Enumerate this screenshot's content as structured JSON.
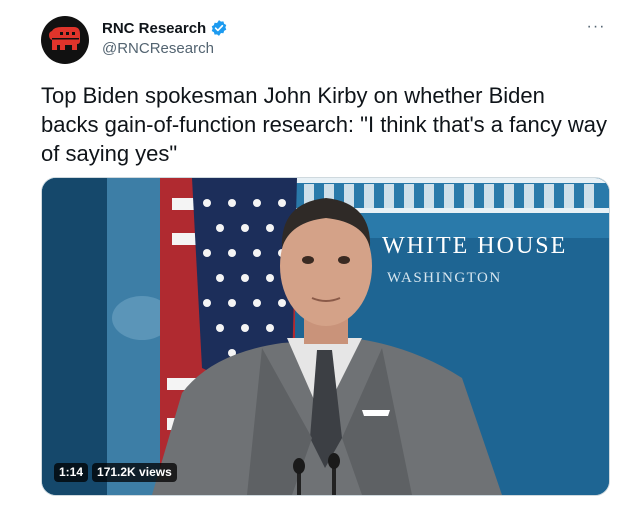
{
  "author": {
    "name": "RNC Research",
    "handle": "@RNCResearch",
    "verified": true,
    "verified_color": "#1d9bf0",
    "avatar_icon": "elephant-logo-icon",
    "avatar_color": "#e0342b"
  },
  "more_icon": "ellipsis-icon",
  "more_label": "···",
  "tweet": {
    "text": "Top Biden spokesman John Kirby on whether Biden backs gain-of-function research: \"I think that's a fancy way of saying yes\""
  },
  "media": {
    "backdrop_line1": "WHITE HOUSE",
    "backdrop_line2": "WASHINGTON",
    "duration": "1:14",
    "views": "171.2K views"
  }
}
